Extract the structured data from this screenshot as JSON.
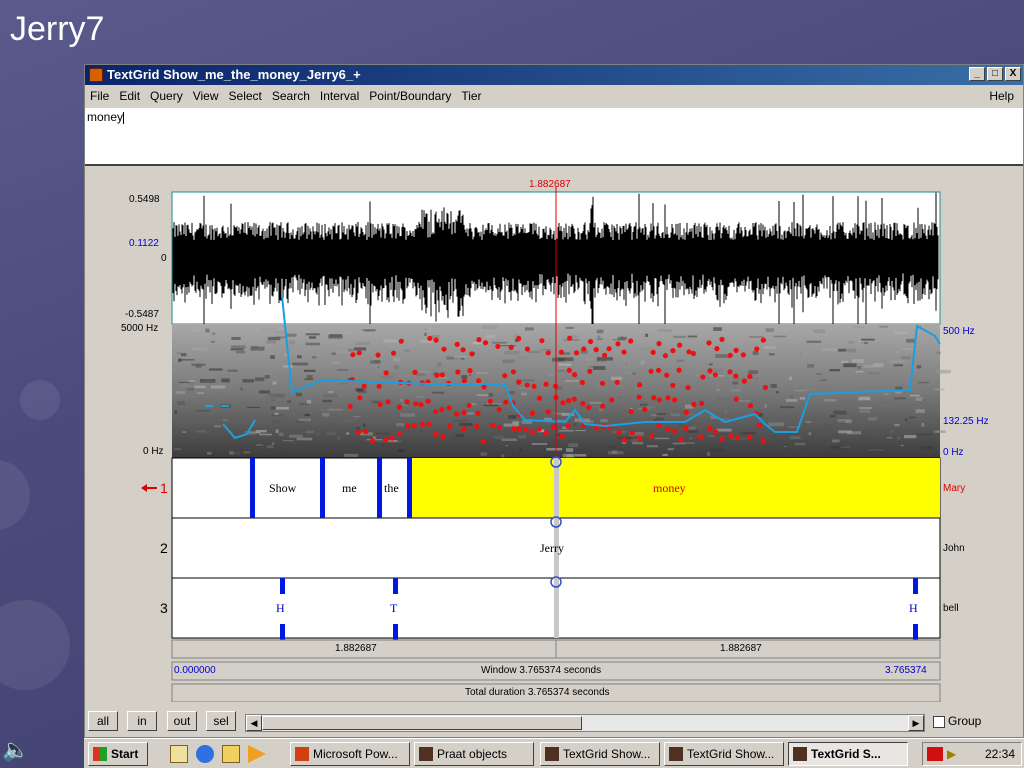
{
  "slide": {
    "title": "Jerry7"
  },
  "window": {
    "title": "TextGrid Show_me_the_money_Jerry6_+",
    "controls": [
      "_",
      "□",
      "X"
    ]
  },
  "menu": {
    "items": [
      "File",
      "Edit",
      "Query",
      "View",
      "Select",
      "Search",
      "Interval",
      "Point/Boundary",
      "Tier"
    ],
    "help": "Help"
  },
  "text_area": {
    "value": "money"
  },
  "editor": {
    "cursor_time": "1.882687",
    "waveform": {
      "ymax": "0.5498",
      "cursor_val": "0.1122",
      "zero": "0",
      "ymin": "-0.5487"
    },
    "spectrogram": {
      "fmax_left": "5000 Hz",
      "fmin_left": "0 Hz",
      "pitch_max": "500 Hz",
      "pitch_cursor": "132.25 Hz",
      "pitch_min": "0 Hz"
    },
    "tiers": [
      {
        "num": "1",
        "name": "Mary",
        "selected": true,
        "intervals": [
          "Show",
          "me",
          "the",
          "money"
        ]
      },
      {
        "num": "2",
        "name": "John",
        "intervals": [
          "Jerry"
        ]
      },
      {
        "num": "3",
        "name": "bell",
        "points": [
          "H",
          "T",
          "H"
        ]
      }
    ],
    "left_duration": "1.882687",
    "right_duration": "1.882687",
    "window_start": "0.000000",
    "window_label": "Window 3.765374 seconds",
    "window_end": "3.765374",
    "total_duration": "Total duration 3.765374 seconds"
  },
  "bottom": {
    "buttons": [
      "all",
      "in",
      "out",
      "sel"
    ],
    "group_label": "Group"
  },
  "taskbar": {
    "start": "Start",
    "items": [
      "Microsoft Pow...",
      "Praat objects",
      "TextGrid Show...",
      "TextGrid Show...",
      "TextGrid S..."
    ],
    "clock": "22:34"
  }
}
